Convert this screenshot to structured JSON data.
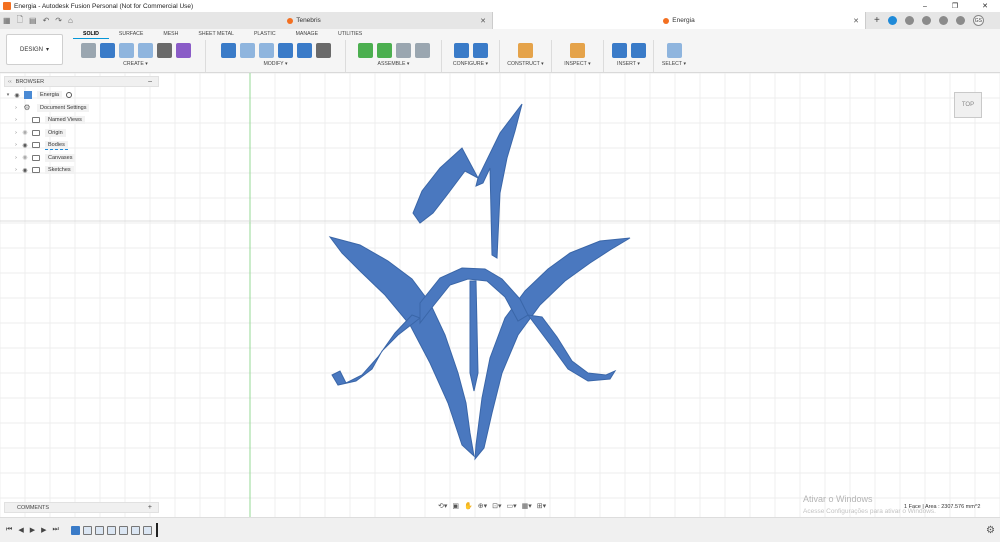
{
  "window": {
    "title": "Energia - Autodesk Fusion Personal (Not for Commercial Use)",
    "minimize": "–",
    "maximize": "❐",
    "close": "✕"
  },
  "qat": {
    "grid": "▦",
    "file": "🗋",
    "save": "▤",
    "undo": "↶",
    "redo": "↷",
    "home": "⌂"
  },
  "tabs": [
    {
      "label": "Tenebris",
      "active": false,
      "close": "✕"
    },
    {
      "label": "Energia",
      "active": true,
      "close": "✕"
    }
  ],
  "tab_right": {
    "new_tab": "+",
    "avatar": "GS"
  },
  "toolbar": {
    "workspace": "DESIGN",
    "workspace_caret": "▾",
    "tabs": [
      "SOLID",
      "SURFACE",
      "MESH",
      "SHEET METAL",
      "PLASTIC",
      "MANAGE",
      "UTILITIES"
    ],
    "active_tab": "SOLID",
    "groups": [
      {
        "label": "CREATE ▾"
      },
      {
        "label": "MODIFY ▾"
      },
      {
        "label": "ASSEMBLE ▾"
      },
      {
        "label": "CONFIGURE ▾"
      },
      {
        "label": "CONSTRUCT ▾"
      },
      {
        "label": "INSPECT ▾"
      },
      {
        "label": "INSERT ▾"
      },
      {
        "label": "SELECT ▾"
      }
    ]
  },
  "browser": {
    "title": "BROWSER",
    "collapse": "–",
    "root": "Energia",
    "items": [
      {
        "label": "Document Settings"
      },
      {
        "label": "Named Views"
      },
      {
        "label": "Origin"
      },
      {
        "label": "Bodies"
      },
      {
        "label": "Canvases"
      },
      {
        "label": "Sketches"
      }
    ]
  },
  "viewcube": {
    "face": "TOP"
  },
  "comments": {
    "title": "COMMENTS",
    "add": "+"
  },
  "watermark": {
    "line1": "Ativar o Windows",
    "line2": "Acesse Configurações para ativar o Windows."
  },
  "status": {
    "text": "1 Face | Area : 2307.576 mm^2"
  },
  "colors": {
    "accent": "#0696d7",
    "body_fill": "#4a78bf",
    "grid_line": "#e6e6e6",
    "fusion_orange": "#f37021"
  },
  "timeline": {
    "first": "⏮",
    "prev": "◀",
    "play": "▶",
    "next": "▶",
    "last": "⏭",
    "settings": "⚙"
  }
}
